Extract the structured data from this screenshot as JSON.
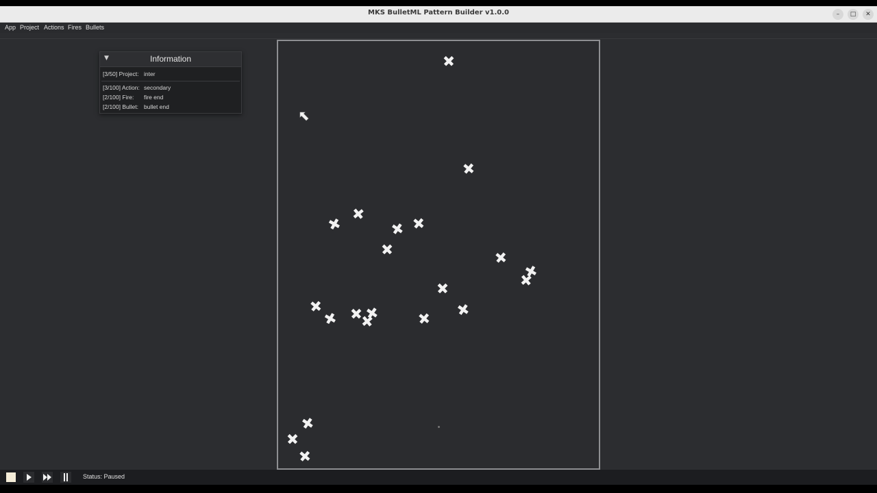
{
  "window": {
    "title": "MKS BulletML Pattern Builder v1.0.0"
  },
  "menu": [
    "App",
    "Project",
    "Actions",
    "Fires",
    "Bullets"
  ],
  "info_panel": {
    "title": "Information",
    "rows": [
      {
        "label": "[3/50] Project:",
        "value": "inter"
      },
      {
        "label": "[3/100] Action:",
        "value": "secondary"
      },
      {
        "label": "[2/100] Fire:",
        "value": "fire end"
      },
      {
        "label": "[2/100] Bullet:",
        "value": "bullet end"
      }
    ]
  },
  "status": {
    "text": "Status: Paused"
  },
  "icons": {
    "bullet": "cross-bullet-icon",
    "emitter": "arrow-emitter-icon",
    "stop": "stop-icon",
    "play": "play-icon",
    "fast_forward": "fast-forward-icon",
    "step": "step-icon"
  },
  "colors": {
    "canvas_bg": "#2b2c2f",
    "workspace_bg": "#2c2d30",
    "bullet": "#f2f2f2"
  }
}
